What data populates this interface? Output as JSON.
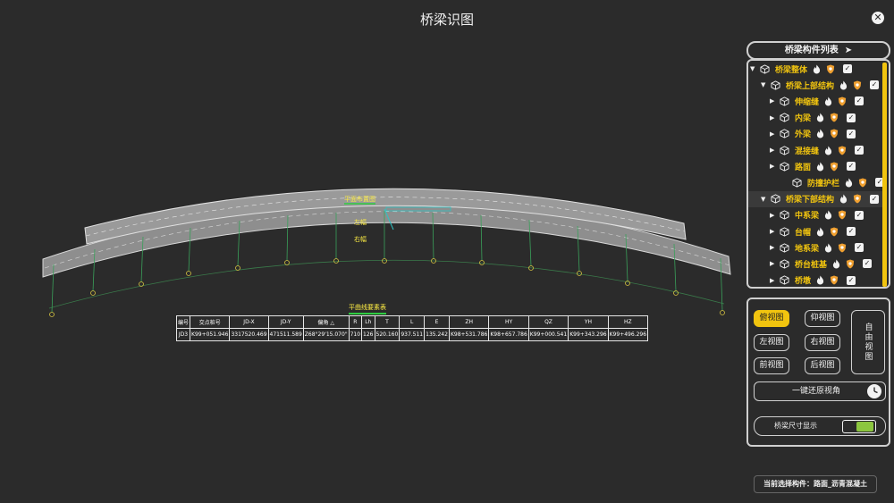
{
  "app": {
    "title": "桥梁识图"
  },
  "colors": {
    "accent": "#f1c40f",
    "toggle_on": "#8cc63f",
    "road_label": "#ffee44",
    "background": "#2b2b2b"
  },
  "drawing": {
    "plan_label": "平面布置图",
    "left_label": "左幅",
    "right_label": "右幅"
  },
  "curve_table": {
    "title": "平曲线要素表",
    "headers": [
      "编号",
      "交点桩号",
      "JD-X",
      "JD-Y",
      "偏角 △",
      "R",
      "Lh",
      "T",
      "L",
      "E",
      "ZH",
      "HY",
      "QZ",
      "YH",
      "HZ"
    ],
    "row": [
      "JD3",
      "K99+051.946",
      "3317520.469",
      "471511.589",
      "Z68°29'15.070\"",
      "710",
      "126",
      "520.160",
      "937.511",
      "135.242",
      "K98+531.786",
      "K98+657.786",
      "K99+000.541",
      "K99+343.296",
      "K99+496.296"
    ]
  },
  "tree": {
    "header": "桥梁构件列表",
    "items": [
      {
        "label": "桥梁整体",
        "expander": "▼",
        "selected": false
      },
      {
        "label": "桥梁上部结构",
        "expander": "▼",
        "selected": false
      },
      {
        "label": "伸缩缝",
        "expander": "▶",
        "selected": false
      },
      {
        "label": "内梁",
        "expander": "▶",
        "selected": false
      },
      {
        "label": "外梁",
        "expander": "▶",
        "selected": false
      },
      {
        "label": "混接缝",
        "expander": "▶",
        "selected": false
      },
      {
        "label": "路面",
        "expander": "▶",
        "selected": false
      },
      {
        "label": "防撞护栏",
        "expander": "",
        "selected": false
      },
      {
        "label": "桥梁下部结构",
        "expander": "▼",
        "selected": true
      },
      {
        "label": "中系梁",
        "expander": "▶",
        "selected": false
      },
      {
        "label": "台帽",
        "expander": "▶",
        "selected": false
      },
      {
        "label": "地系梁",
        "expander": "▶",
        "selected": false
      },
      {
        "label": "桥台桩基",
        "expander": "▶",
        "selected": false
      },
      {
        "label": "桥墩",
        "expander": "▶",
        "selected": false
      }
    ]
  },
  "views": {
    "top": "俯视图",
    "bottom": "仰视图",
    "left": "左视图",
    "right": "右视图",
    "front": "前视图",
    "back": "后视图",
    "free": "自由视图",
    "reset": "一键还原视角",
    "dimension_toggle": "桥梁尺寸显示"
  },
  "status": {
    "text": "当前选择构件：路面_沥青混凝土"
  }
}
